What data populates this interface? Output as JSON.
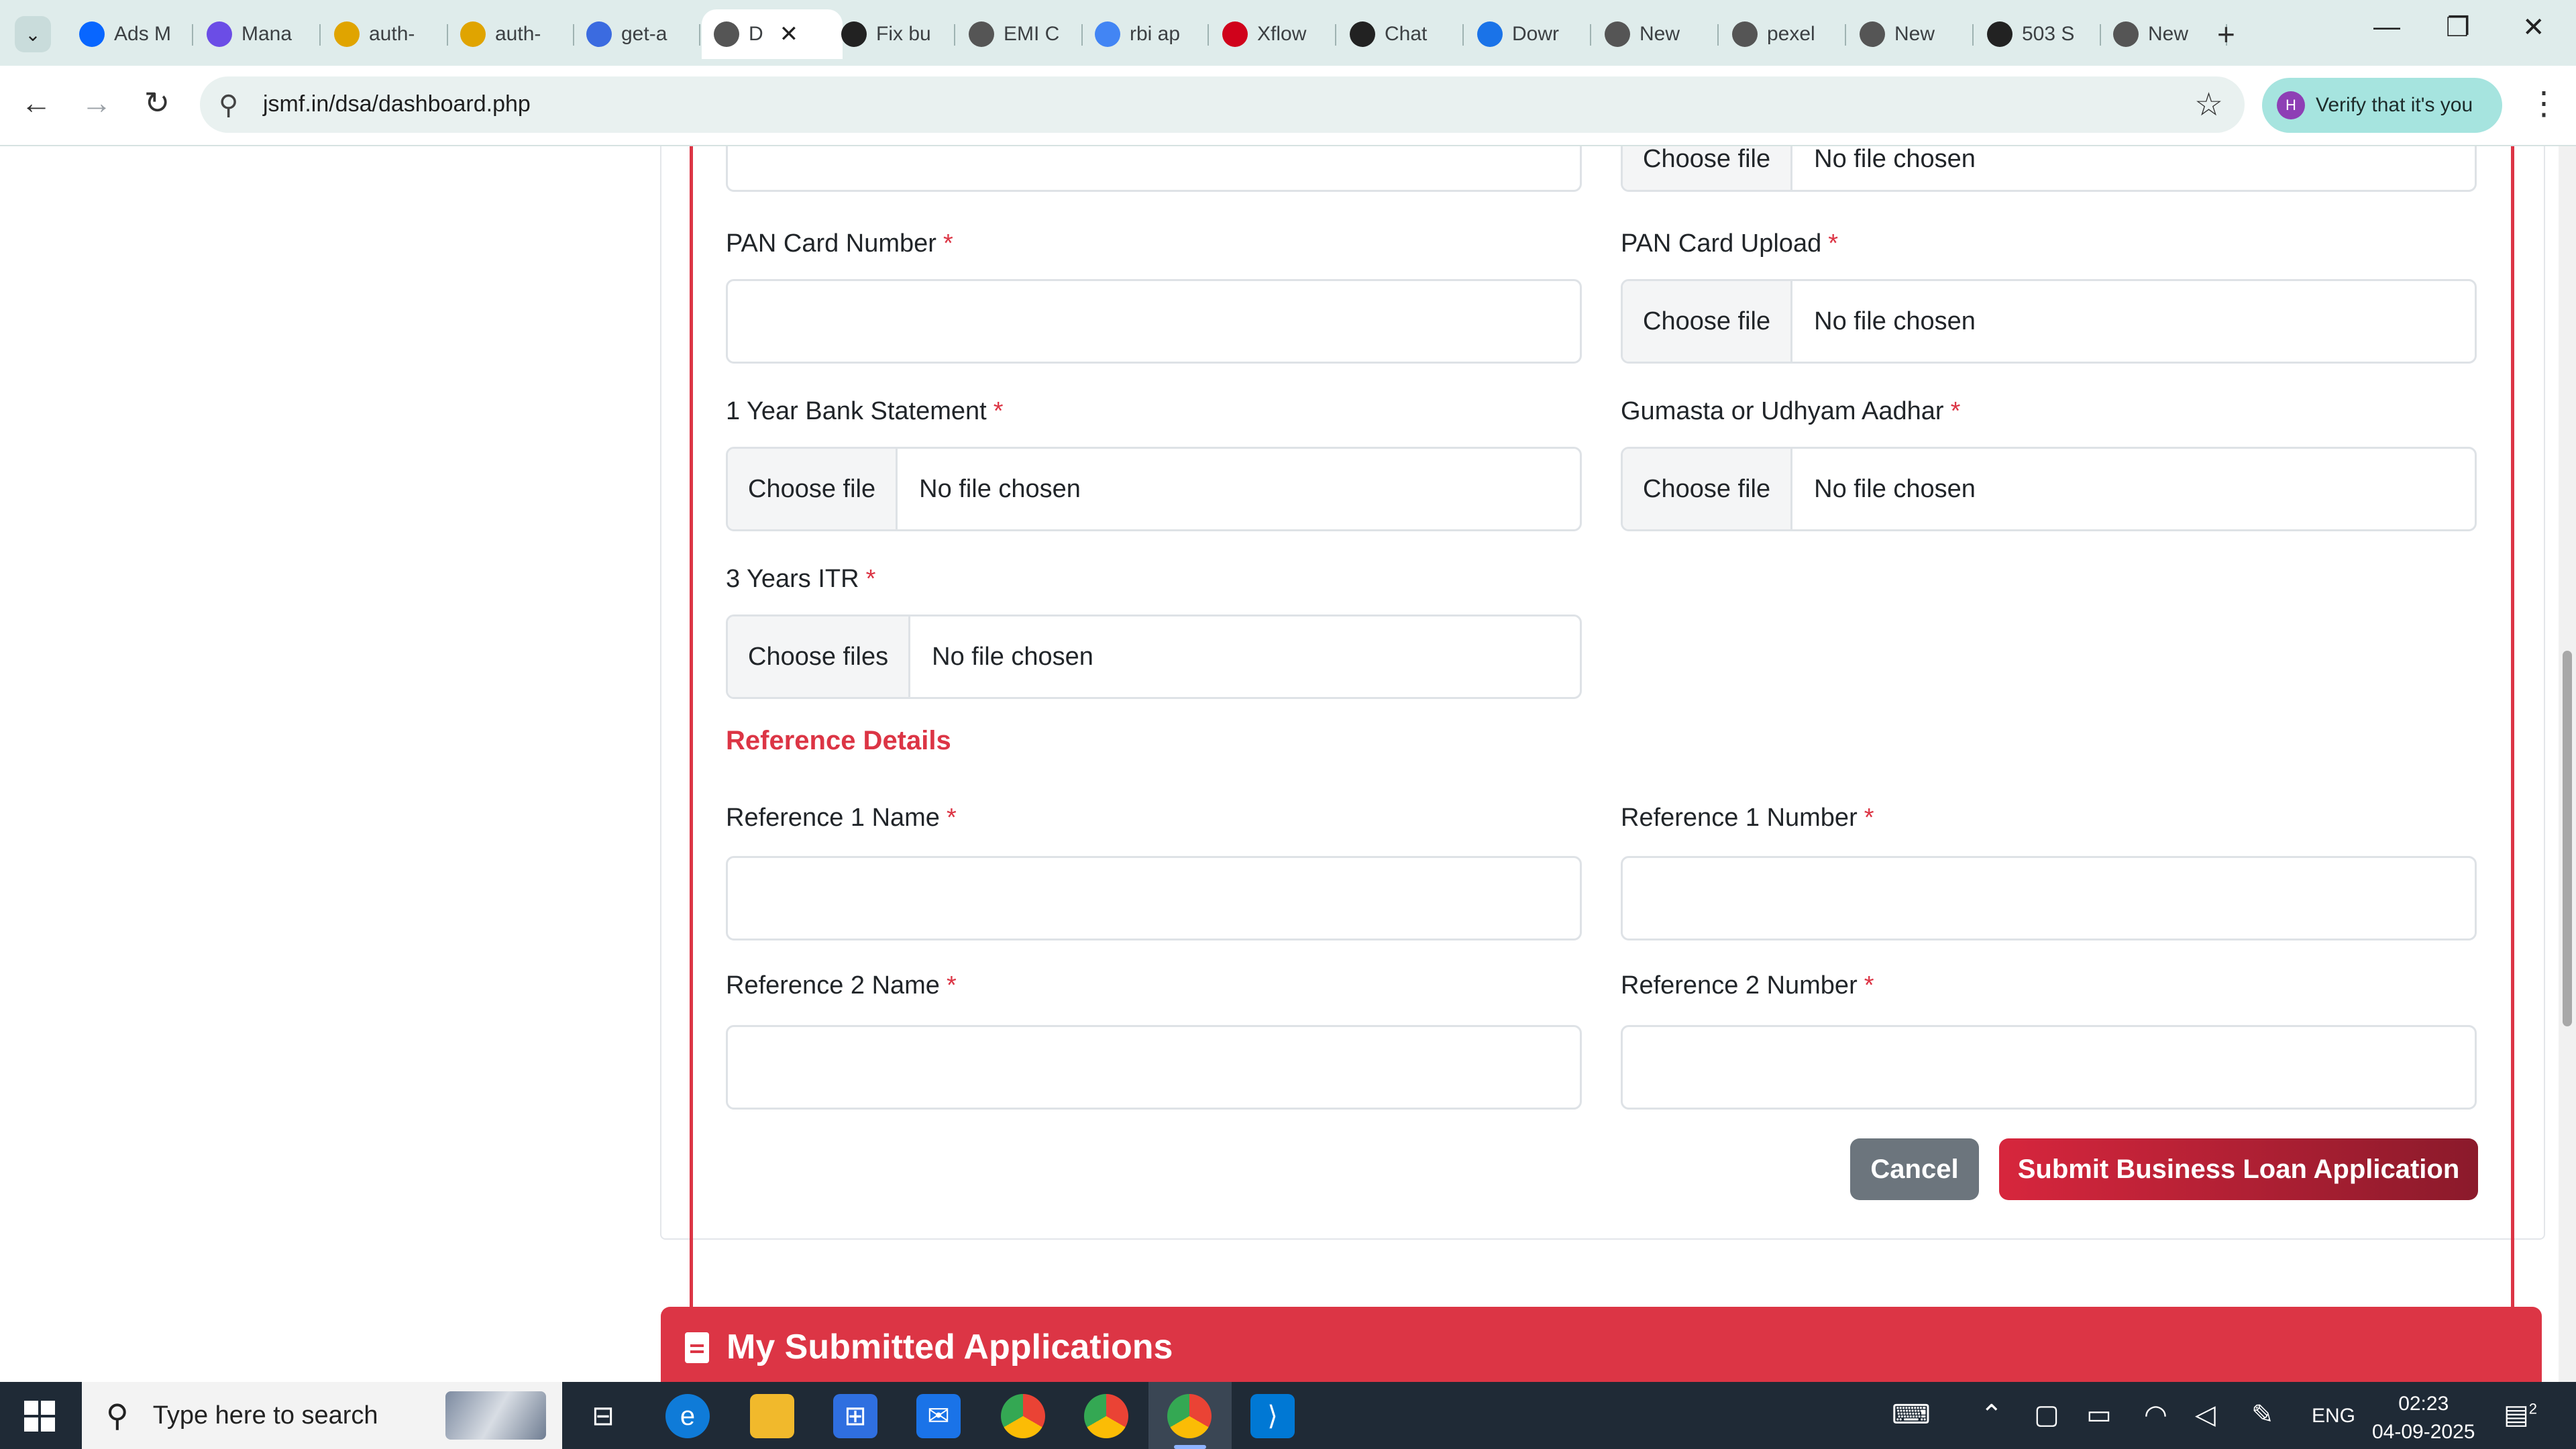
{
  "browser": {
    "tabs": [
      {
        "label": "Ads M",
        "icon": "meta-icon",
        "color": "#0866ff"
      },
      {
        "label": "Mana",
        "icon": "h-logo-icon",
        "color": "#6b4de6"
      },
      {
        "label": "auth-",
        "icon": "pma-icon",
        "color": "#e0a400"
      },
      {
        "label": "auth-",
        "icon": "pma-icon",
        "color": "#e0a400"
      },
      {
        "label": "get-a",
        "icon": "github-copilot-icon",
        "color": "#3b6be0"
      },
      {
        "label": "D",
        "icon": "globe-icon",
        "color": "#555555"
      },
      {
        "label": "Fix bu",
        "icon": "openai-icon",
        "color": "#222222"
      },
      {
        "label": "EMI C",
        "icon": "globe-icon",
        "color": "#555555"
      },
      {
        "label": "rbi ap",
        "icon": "google-icon",
        "color": "#4285f4"
      },
      {
        "label": "Xflow",
        "icon": "xflow-icon",
        "color": "#d0021b"
      },
      {
        "label": "Chat",
        "icon": "openai-icon",
        "color": "#222222"
      },
      {
        "label": "Dowr",
        "icon": "download-icon",
        "color": "#1a73e8"
      },
      {
        "label": "New",
        "icon": "chrome-icon",
        "color": "#555555"
      },
      {
        "label": "pexel",
        "icon": "globe-icon",
        "color": "#555555"
      },
      {
        "label": "New",
        "icon": "chrome-icon",
        "color": "#555555"
      },
      {
        "label": "503 S",
        "icon": "invision-icon",
        "color": "#222222"
      },
      {
        "label": "New",
        "icon": "chrome-icon",
        "color": "#555555"
      }
    ],
    "active_tab_index": 5,
    "url": "jsmf.in/dsa/dashboard.php",
    "profile_label": "Verify that it's you",
    "profile_initial": "H"
  },
  "form": {
    "top_file": {
      "button": "Choose file",
      "status": "No file chosen"
    },
    "pan_number_label": "PAN Card Number",
    "pan_upload_label": "PAN Card Upload",
    "pan_upload": {
      "button": "Choose file",
      "status": "No file chosen"
    },
    "bank_statement_label": "1 Year Bank Statement",
    "bank_statement": {
      "button": "Choose file",
      "status": "No file chosen"
    },
    "gumasta_label": "Gumasta or Udhyam Aadhar",
    "gumasta": {
      "button": "Choose file",
      "status": "No file chosen"
    },
    "itr_label": "3 Years ITR",
    "itr": {
      "button": "Choose files",
      "status": "No file chosen"
    },
    "required_mark": "*",
    "reference_section_title": "Reference Details",
    "ref1_name_label": "Reference 1 Name",
    "ref1_number_label": "Reference 1 Number",
    "ref2_name_label": "Reference 2 Name",
    "ref2_number_label": "Reference 2 Number",
    "cancel_label": "Cancel",
    "submit_label": "Submit Business Loan Application"
  },
  "applications": {
    "title": "My Submitted Applications"
  },
  "colors": {
    "accent": "#dc3545",
    "cancel": "#6c757d",
    "submit_gradient_end": "#8b1a2b"
  },
  "taskbar": {
    "search_placeholder": "Type here to search",
    "language": "ENG",
    "time": "02:23",
    "date": "04-09-2025",
    "notifications": "2"
  }
}
